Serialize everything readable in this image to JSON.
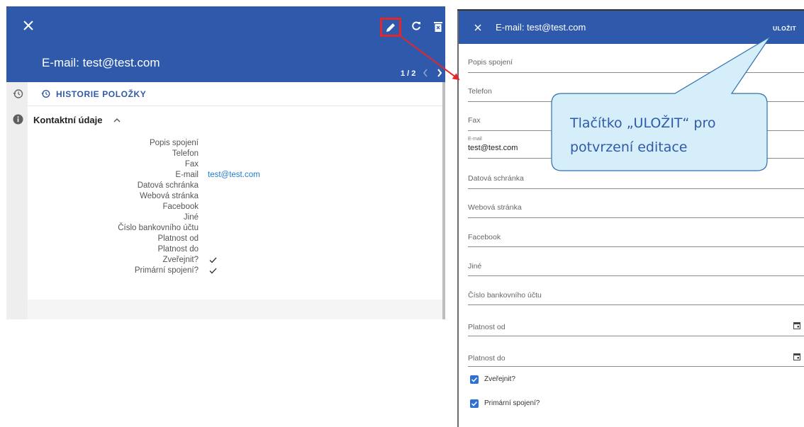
{
  "left": {
    "title": "E-mail: test@test.com",
    "pager": "1 / 2",
    "history_label": "HISTORIE POLOŽKY",
    "section_title": "Kontaktní údaje",
    "rows": [
      {
        "label": "Popis spojení",
        "value": ""
      },
      {
        "label": "Telefon",
        "value": ""
      },
      {
        "label": "Fax",
        "value": ""
      },
      {
        "label": "E-mail",
        "value": "test@test.com"
      },
      {
        "label": "Datová schránka",
        "value": ""
      },
      {
        "label": "Webová stránka",
        "value": ""
      },
      {
        "label": "Facebook",
        "value": ""
      },
      {
        "label": "Jiné",
        "value": ""
      },
      {
        "label": "Číslo bankovního účtu",
        "value": ""
      },
      {
        "label": "Platnost od",
        "value": ""
      },
      {
        "label": "Platnost do",
        "value": ""
      },
      {
        "label": "Zveřejnit?",
        "checked": true
      },
      {
        "label": "Primární spojení?",
        "checked": true
      }
    ],
    "icons": {
      "close": "close-icon",
      "edit": "pencil-icon",
      "refresh": "refresh-icon",
      "delete": "trash-icon",
      "history": "history-icon",
      "info": "info-icon"
    }
  },
  "right": {
    "title": "E-mail: test@test.com",
    "save_label": "ULOŽIT",
    "fields": {
      "popis": "Popis spojení",
      "telefon": "Telefon",
      "fax": "Fax",
      "email_label": "E-mail",
      "email_value": "test@test.com",
      "datova": "Datová schránka",
      "web": "Webová stránka",
      "facebook": "Facebook",
      "jine": "Jiné",
      "ucet": "Číslo bankovního účtu",
      "od": "Platnost od",
      "do": "Platnost do"
    },
    "checkboxes": {
      "zverejnit": {
        "label": "Zveřejnit?",
        "checked": true
      },
      "primarni": {
        "label": "Primární spojení?",
        "checked": true
      }
    }
  },
  "callout": {
    "line1": "Tlačítko „ULOŽIT“ pro",
    "line2": "potvrzení editace"
  },
  "colors": {
    "header": "#2f5aab",
    "link": "#1f7ad1",
    "highlight": "#e3262a",
    "callout_fill": "#d6eefa"
  }
}
